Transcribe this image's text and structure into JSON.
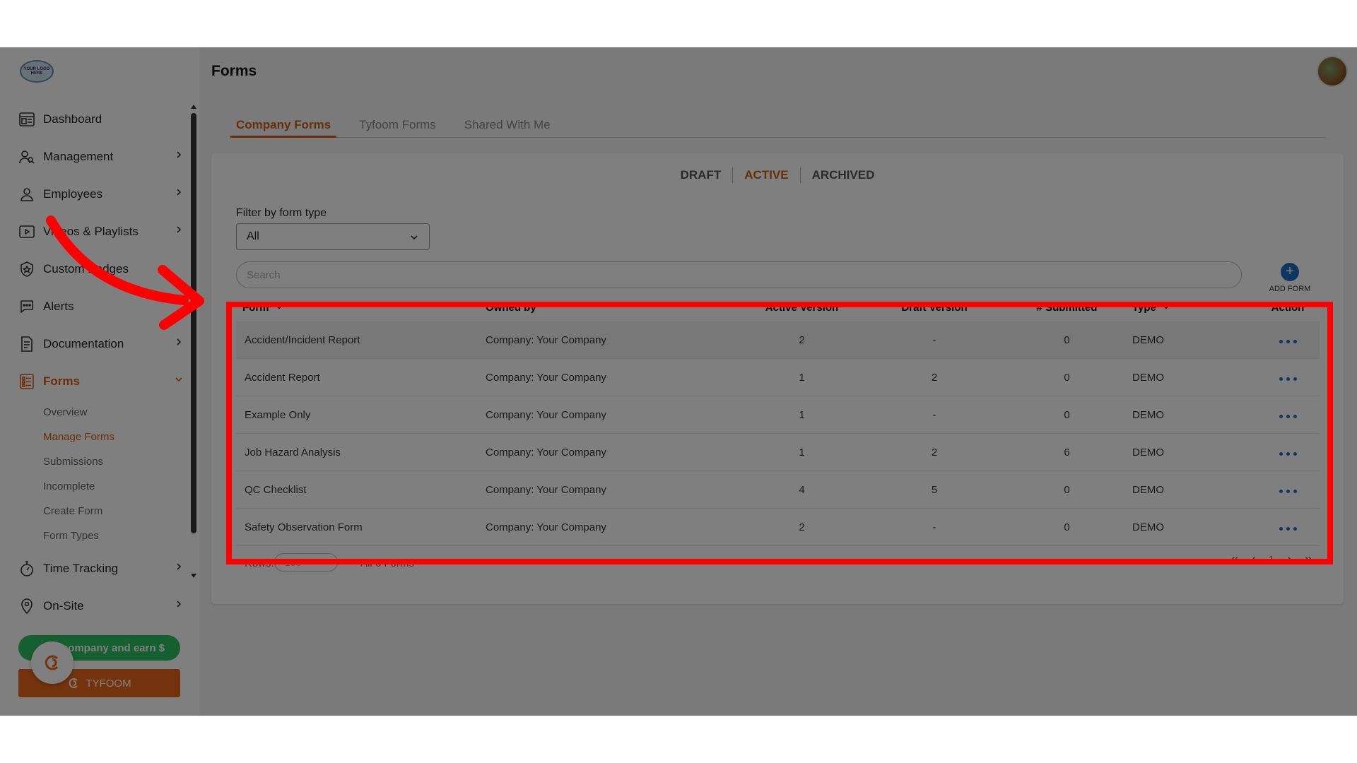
{
  "app": {
    "logo_text": "YOUR LOGO HERE",
    "page_title": "Forms"
  },
  "sidebar": {
    "items": [
      {
        "label": "Dashboard",
        "icon": "dashboard-icon",
        "has_chevron": false
      },
      {
        "label": "Management",
        "icon": "management-icon",
        "has_chevron": true
      },
      {
        "label": "Employees",
        "icon": "user-icon",
        "has_chevron": true
      },
      {
        "label": "Videos & Playlists",
        "icon": "video-icon",
        "has_chevron": true
      },
      {
        "label": "Custom Badges",
        "icon": "badge-icon",
        "has_chevron": false
      },
      {
        "label": "Alerts",
        "icon": "chat-icon",
        "has_chevron": false
      },
      {
        "label": "Documentation",
        "icon": "document-icon",
        "has_chevron": true
      },
      {
        "label": "Forms",
        "icon": "forms-icon",
        "has_chevron": true
      }
    ],
    "sub_items": [
      {
        "label": "Overview"
      },
      {
        "label": "Manage Forms"
      },
      {
        "label": "Submissions"
      },
      {
        "label": "Incomplete"
      },
      {
        "label": "Create Form"
      },
      {
        "label": "Form Types"
      }
    ],
    "bottom_items": [
      {
        "label": "Time Tracking",
        "icon": "stopwatch-icon"
      },
      {
        "label": "On-Site",
        "icon": "location-pin-icon"
      }
    ],
    "refer_label": "company and earn $",
    "tyfoom_label": "TYFOOM"
  },
  "tabs": [
    "Company Forms",
    "Tyfoom Forms",
    "Shared With Me"
  ],
  "status_tabs": [
    "DRAFT",
    "ACTIVE",
    "ARCHIVED"
  ],
  "filter": {
    "label": "Filter by form type",
    "value": "All"
  },
  "search": {
    "placeholder": "Search"
  },
  "add_form_label": "ADD FORM",
  "table": {
    "headers": {
      "form": "Form",
      "owner": "Owned by",
      "active": "Active Version",
      "draft": "Draft Version",
      "submitted": "# Submitted",
      "type": "Type",
      "action": "Action"
    },
    "rows": [
      {
        "form": "Accident/Incident Report",
        "owner": "Company: Your Company",
        "active": "2",
        "draft": "-",
        "submitted": "0",
        "type": "DEMO"
      },
      {
        "form": "Accident Report",
        "owner": "Company: Your Company",
        "active": "1",
        "draft": "2",
        "submitted": "0",
        "type": "DEMO"
      },
      {
        "form": "Example Only",
        "owner": "Company: Your Company",
        "active": "1",
        "draft": "-",
        "submitted": "0",
        "type": "DEMO"
      },
      {
        "form": "Job Hazard Analysis",
        "owner": "Company: Your Company",
        "active": "1",
        "draft": "2",
        "submitted": "6",
        "type": "DEMO"
      },
      {
        "form": "QC Checklist",
        "owner": "Company: Your Company",
        "active": "4",
        "draft": "5",
        "submitted": "0",
        "type": "DEMO"
      },
      {
        "form": "Safety Observation Form",
        "owner": "Company: Your Company",
        "active": "2",
        "draft": "-",
        "submitted": "0",
        "type": "DEMO"
      }
    ]
  },
  "footer": {
    "rows_label": "Rows:",
    "rows_value": "100",
    "total_label": "All 6 Forms",
    "current_page": "1"
  },
  "colors": {
    "accent": "#d35a12",
    "link_blue": "#1a6fc4",
    "highlight": "#ff0000",
    "refer_green": "#2dbe60",
    "tyfoom_orange": "#e8661a"
  }
}
